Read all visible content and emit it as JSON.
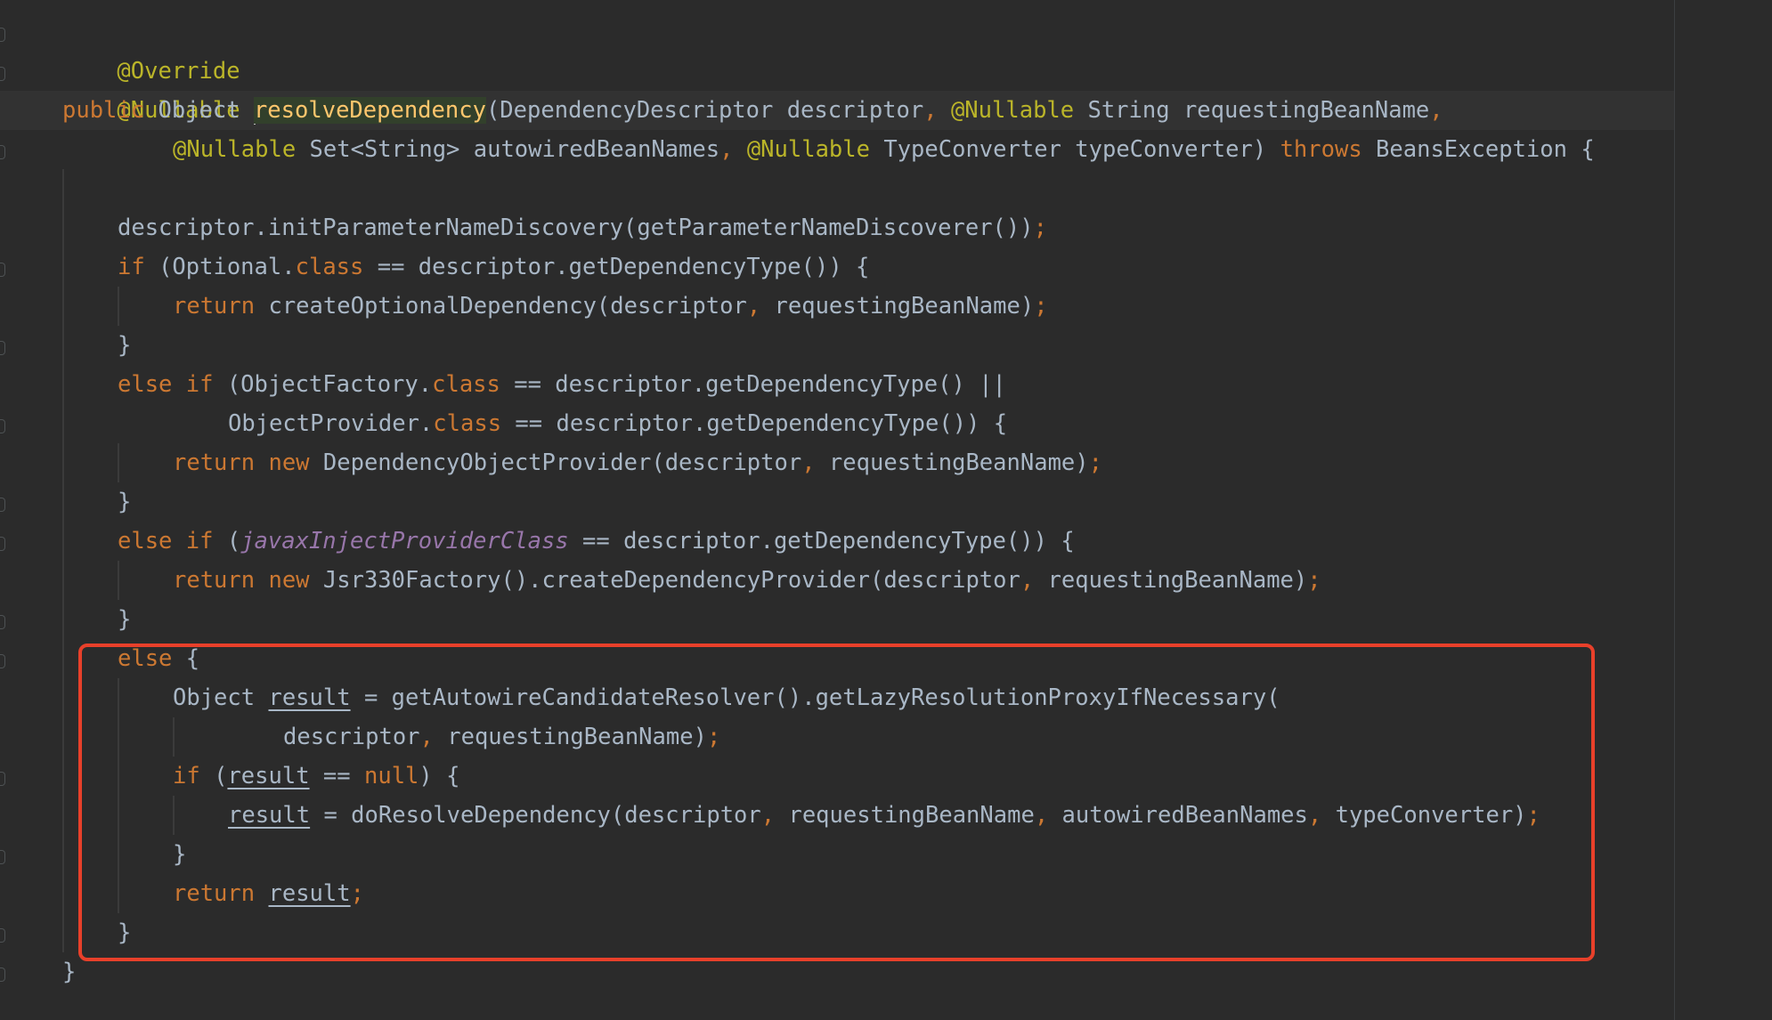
{
  "code": {
    "l1_annotation": "@Override",
    "l2_annotation": "@Nullable",
    "l3": {
      "kw_public": "public",
      "type_object": " Object ",
      "method_name": "resolveDependency",
      "params_1": "(DependencyDescriptor descriptor",
      "comma": ",",
      "annotation": "@Nullable",
      "params_2": " String requestingBeanName"
    },
    "l4": {
      "ann1": "@Nullable",
      "text1": " Set<String> autowiredBeanNames",
      "ann2": "@Nullable",
      "text2": " TypeConverter typeConverter) ",
      "kw_throws": "throws",
      "text3": " BeansException {"
    },
    "l6": "descriptor.initParameterNameDiscovery(getParameterNameDiscoverer())",
    "l7": {
      "kw_if": "if",
      "text1": " (Optional.",
      "kw_class": "class",
      "text2": " == descriptor.getDependencyType()) {"
    },
    "l8": {
      "kw_return": "return",
      "text1": " createOptionalDependency(descriptor",
      "text2": " requestingBeanName)"
    },
    "close_brace": "}",
    "l10": {
      "kw_else_if": "else if",
      "text1": " (ObjectFactory.",
      "kw_class": "class",
      "text2": " == descriptor.getDependencyType() ||"
    },
    "l11": {
      "text1": "ObjectProvider.",
      "kw_class": "class",
      "text2": " == descriptor.getDependencyType()) {"
    },
    "l12": {
      "kw_return_new": "return new",
      "text1": " DependencyObjectProvider(descriptor",
      "text2": " requestingBeanName)"
    },
    "l14": {
      "kw_else_if": "else if",
      "text1": " (",
      "static_field": "javaxInjectProviderClass",
      "text2": " == descriptor.getDependencyType()) {"
    },
    "l15": {
      "kw_return_new": "return new",
      "text1": " Jsr330Factory().createDependencyProvider(descriptor",
      "text2": " requestingBeanName)"
    },
    "l17": {
      "kw_else": "else",
      "text1": " {"
    },
    "l18": {
      "text1": "Object ",
      "var_result": "result",
      "text2": " = getAutowireCandidateResolver().getLazyResolutionProxyIfNecessary("
    },
    "l19": {
      "text1": "descriptor",
      "text2": " requestingBeanName)"
    },
    "l20": {
      "kw_if": "if",
      "text1": " (",
      "var_result": "result",
      "text2": " == ",
      "kw_null": "null",
      "text3": ") {"
    },
    "l21": {
      "var_result": "result",
      "text1": " = doResolveDependency(descriptor",
      "text2": " requestingBeanName",
      "text3": " autowiredBeanNames",
      "text4": " typeConverter)"
    },
    "l23": {
      "kw_return": "return",
      "var_result": "result"
    }
  }
}
